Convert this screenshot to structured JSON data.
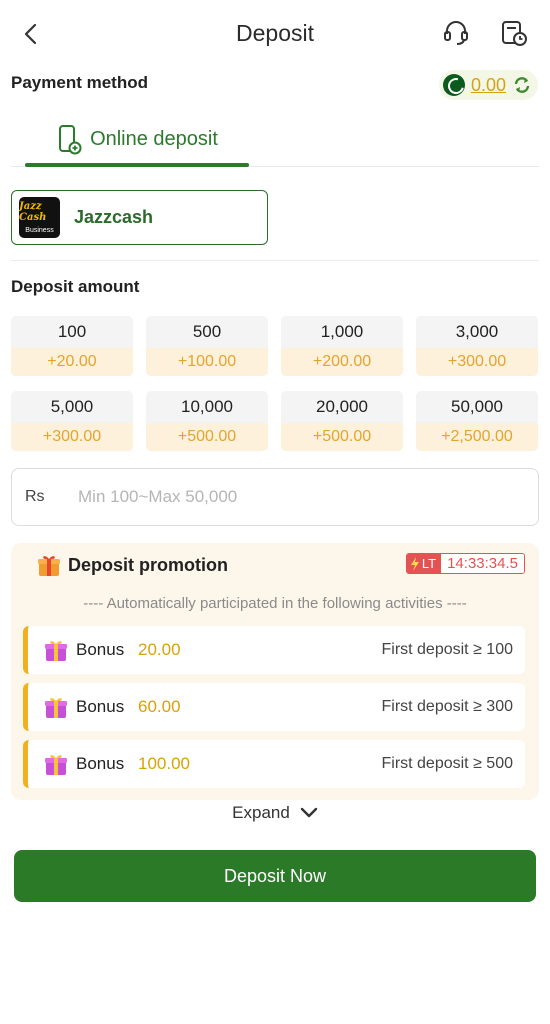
{
  "header": {
    "title": "Deposit"
  },
  "payment": {
    "label": "Payment method",
    "balance": "0.00",
    "tab_label": "Online deposit",
    "method_name": "Jazzcash",
    "logo_text_top": "Jazz Cash",
    "logo_text_bottom": "Business"
  },
  "deposit": {
    "label": "Deposit amount",
    "options": [
      {
        "amount": "100",
        "bonus": "+20.00"
      },
      {
        "amount": "500",
        "bonus": "+100.00"
      },
      {
        "amount": "1,000",
        "bonus": "+200.00"
      },
      {
        "amount": "3,000",
        "bonus": "+300.00"
      },
      {
        "amount": "5,000",
        "bonus": "+300.00"
      },
      {
        "amount": "10,000",
        "bonus": "+500.00"
      },
      {
        "amount": "20,000",
        "bonus": "+500.00"
      },
      {
        "amount": "50,000",
        "bonus": "+2,500.00"
      }
    ],
    "currency_prefix": "Rs",
    "placeholder": "Min 100~Max 50,000"
  },
  "promotion": {
    "title": "Deposit promotion",
    "badge": "LT",
    "countdown": "14:33:34.5",
    "auto_text": "---- Automatically participated in the following activities ----",
    "rows": [
      {
        "label": "Bonus",
        "amount": "20.00",
        "condition": "First deposit ≥ 100"
      },
      {
        "label": "Bonus",
        "amount": "60.00",
        "condition": "First deposit ≥ 300"
      },
      {
        "label": "Bonus",
        "amount": "100.00",
        "condition": "First deposit ≥ 500"
      }
    ],
    "expand_label": "Expand"
  },
  "actions": {
    "deposit_now": "Deposit Now"
  },
  "colors": {
    "primary_green": "#2a7a27",
    "bonus_gold": "#e2a52e",
    "timer_red": "#e25353"
  },
  "icons": [
    "back-arrow-icon",
    "headset-icon",
    "history-icon",
    "pakistan-flag-icon",
    "refresh-icon",
    "phone-deposit-icon",
    "gift-icon",
    "lightning-icon",
    "chevron-down-icon"
  ]
}
